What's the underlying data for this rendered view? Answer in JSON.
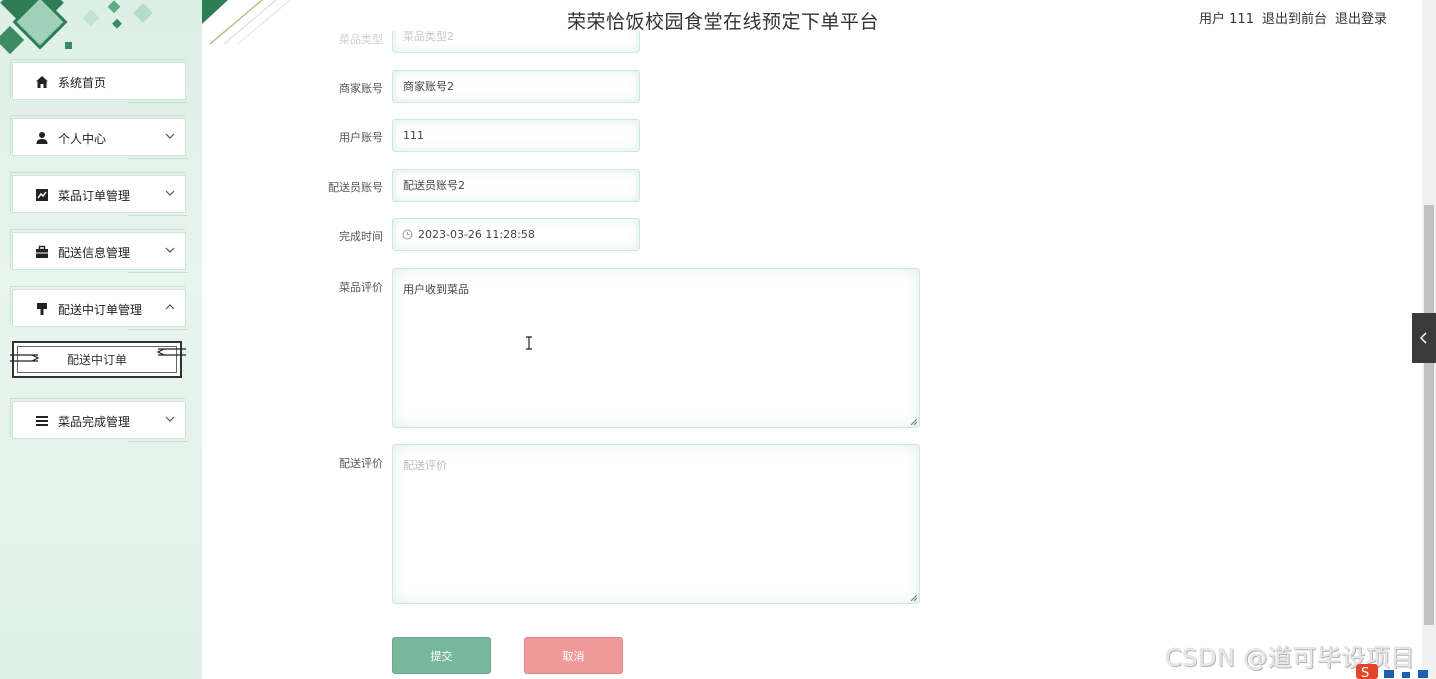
{
  "header": {
    "title": "荣荣恰饭校园食堂在线预定下单平台",
    "user_label": "用户 111",
    "to_front": "退出到前台",
    "logout": "退出登录"
  },
  "sidebar": {
    "items": [
      {
        "label": "系统首页",
        "icon": "home-icon"
      },
      {
        "label": "个人中心",
        "icon": "user-icon"
      },
      {
        "label": "菜品订单管理",
        "icon": "chart-icon"
      },
      {
        "label": "配送信息管理",
        "icon": "briefcase-icon"
      },
      {
        "label": "配送中订单管理",
        "icon": "stamp-icon"
      },
      {
        "label": "菜品完成管理",
        "icon": "list-icon"
      }
    ],
    "sub_item": "配送中订单"
  },
  "form": {
    "dish_type_label": "菜品类型",
    "dish_type_value": "菜品类型2",
    "merchant_label": "商家账号",
    "merchant_value": "商家账号2",
    "user_label": "用户账号",
    "user_value": "111",
    "courier_label": "配送员账号",
    "courier_value": "配送员账号2",
    "finish_time_label": "完成时间",
    "finish_time_value": "2023-03-26 11:28:58",
    "dish_review_label": "菜品评价",
    "dish_review_value": "用户收到菜品",
    "delivery_review_label": "配送评价",
    "delivery_review_placeholder": "配送评价",
    "submit": "提交",
    "cancel": "取消"
  },
  "watermark": "CSDN @道可毕设项目",
  "colors": {
    "accent": "#7ab89e",
    "cancel": "#ef9a9a",
    "sidebar_bg": "#dcefe6"
  }
}
